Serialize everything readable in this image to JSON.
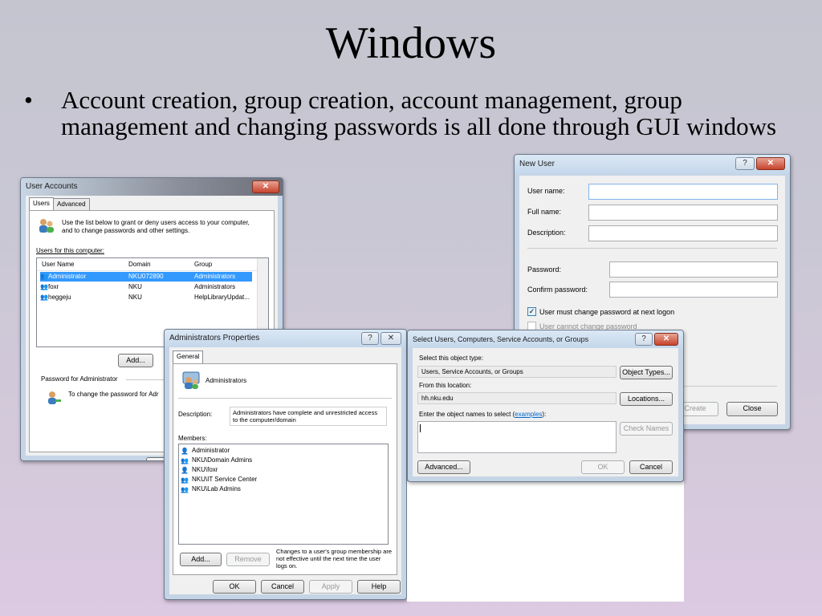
{
  "slide": {
    "title": "Windows",
    "bullet": "Account creation, group creation, account management, group management and changing passwords is all done through GUI windows"
  },
  "user_accounts": {
    "title": "User Accounts",
    "tabs": [
      "Users",
      "Advanced"
    ],
    "intro": "Use the list below to grant or deny users access to your computer, and to change passwords and other settings.",
    "users_label": "Users for this computer:",
    "columns": [
      "User Name",
      "Domain",
      "Group"
    ],
    "rows": [
      {
        "name": "Administrator",
        "domain": "NKU072890",
        "group": "Administrators"
      },
      {
        "name": "foxr",
        "domain": "NKU",
        "group": "Administrators"
      },
      {
        "name": "heggeju",
        "domain": "NKU",
        "group": "HelpLibraryUpdat..."
      }
    ],
    "add_label": "Add...",
    "password_group": "Password for Administrator",
    "password_text": "To change the password for Adr",
    "ok_partial": "C"
  },
  "admin_props": {
    "title": "Administrators Properties",
    "tab": "General",
    "group_name": "Administrators",
    "desc_label": "Description:",
    "desc_value": "Administrators have complete and unrestricted access to the computer/domain",
    "members_label": "Members:",
    "members": [
      "Administrator",
      "NKU\\Domain Admins",
      "NKU\\foxr",
      "NKU\\IT Service Center",
      "NKU\\Lab Admins"
    ],
    "add_label": "Add...",
    "remove_label": "Remove",
    "note": "Changes to a user's group membership are not effective until the next time the user logs on.",
    "ok": "OK",
    "cancel": "Cancel",
    "apply": "Apply",
    "help": "Help"
  },
  "select_users": {
    "title": "Select Users, Computers, Service Accounts, or Groups",
    "type_label": "Select this object type:",
    "type_value": "Users, Service Accounts, or Groups",
    "object_types": "Object Types...",
    "location_label": "From this location:",
    "location_value": "hh.nku.edu",
    "locations": "Locations...",
    "names_label_a": "Enter the object names to select (",
    "names_link": "examples",
    "names_label_b": "):",
    "check_names": "Check Names",
    "advanced": "Advanced...",
    "ok": "OK",
    "cancel": "Cancel"
  },
  "new_user": {
    "title": "New User",
    "username_label": "User name:",
    "fullname_label": "Full name:",
    "description_label": "Description:",
    "password_label": "Password:",
    "confirm_label": "Confirm password:",
    "must_change": "User must change password at next logon",
    "cannot_change": "User cannot change password",
    "create": "Create",
    "close": "Close"
  },
  "colors": {
    "selection": "#3399ff",
    "link": "#0066cc",
    "close_button": "#c7432b"
  }
}
